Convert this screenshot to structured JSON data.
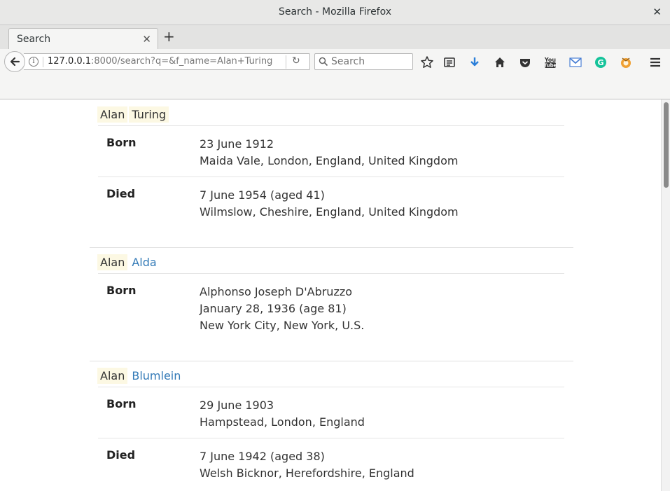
{
  "window": {
    "title": "Search - Mozilla Firefox"
  },
  "tab": {
    "label": "Search"
  },
  "urlbar": {
    "host": "127.0.0.1",
    "rest": ":8000/search?q=&f_name=Alan+Turing"
  },
  "search": {
    "placeholder": "Search"
  },
  "toolbar_icons": [
    "star-icon",
    "reading-list-icon",
    "download-icon",
    "home-icon",
    "pocket-icon",
    "youtube-icon",
    "gmail-icon",
    "grammarly-icon",
    "extension-icon",
    "menu-icon"
  ],
  "colors": {
    "highlight": "#fcf8e3",
    "link": "#337ab7"
  },
  "results": [
    {
      "first": "Alan",
      "last": "Turing",
      "last_is_link": false,
      "born_label": "Born",
      "born_line1": "23 June 1912",
      "born_line2": "Maida Vale, London, England, United Kingdom",
      "died_label": "Died",
      "died_line1": "7 June 1954 (aged 41)",
      "died_line2": "Wilmslow, Cheshire, England, United Kingdom"
    },
    {
      "first": "Alan",
      "last": "Alda",
      "last_is_link": true,
      "born_label": "Born",
      "born_line1": "Alphonso Joseph D'Abruzzo",
      "born_line2": "January 28, 1936 (age 81)",
      "born_line3": "New York City, New York, U.S."
    },
    {
      "first": "Alan",
      "last": "Blumlein",
      "last_is_link": true,
      "born_label": "Born",
      "born_line1": "29 June 1903",
      "born_line2": "Hampstead, London, England",
      "died_label": "Died",
      "died_line1": "7 June 1942 (aged 38)",
      "died_line2": "Welsh Bicknor, Herefordshire, England"
    }
  ]
}
